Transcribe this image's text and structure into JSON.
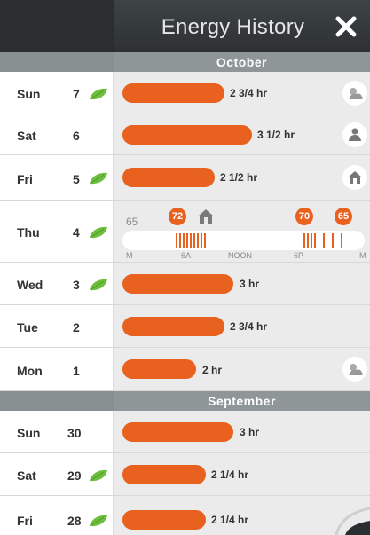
{
  "header": {
    "title": "Energy History"
  },
  "months": {
    "october": "October",
    "september": "September"
  },
  "rows": [
    {
      "day": "Sun",
      "date": "7",
      "leaf": true,
      "hours": "2 3/4 hr",
      "icon": "weather-icon"
    },
    {
      "day": "Sat",
      "date": "6",
      "leaf": false,
      "hours": "3 1/2 hr",
      "icon": "person-icon"
    },
    {
      "day": "Fri",
      "date": "5",
      "leaf": true,
      "hours": "2 1/2 hr",
      "icon": "away-house-icon"
    },
    {
      "day": "Thu",
      "date": "4",
      "leaf": true
    },
    {
      "day": "Wed",
      "date": "3",
      "leaf": true,
      "hours": "3 hr"
    },
    {
      "day": "Tue",
      "date": "2",
      "leaf": false,
      "hours": "2 3/4 hr"
    },
    {
      "day": "Mon",
      "date": "1",
      "leaf": false,
      "hours": "2 hr",
      "icon": "weather-icon"
    },
    {
      "day": "Sun",
      "date": "30",
      "leaf": false,
      "hours": "3 hr"
    },
    {
      "day": "Sat",
      "date": "29",
      "leaf": true,
      "hours": "2 1/4 hr"
    },
    {
      "day": "Fri",
      "date": "28",
      "leaf": true,
      "hours": "2 1/4 hr"
    }
  ],
  "timeline": {
    "start_temp": "65",
    "badges": [
      "72",
      "70",
      "65"
    ],
    "axis": {
      "m_start": "M",
      "six_a": "6A",
      "noon": "NOON",
      "six_p": "6P",
      "m_end": "M"
    }
  },
  "colors": {
    "accent": "#e8611e",
    "leaf": "#6dbe3c",
    "header": "#363a3c",
    "month_bar": "#8e9698",
    "row_bg": "#ebebeb"
  }
}
